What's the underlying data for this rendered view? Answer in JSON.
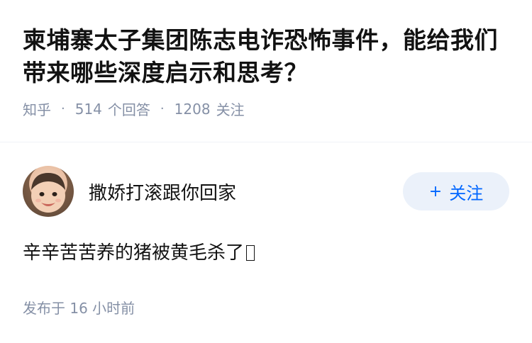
{
  "question": {
    "title": "柬埔寨太子集团陈志电诈恐怖事件，能给我们带来哪些深度启示和思考？",
    "source": "知乎",
    "answer_count": "514",
    "answer_label": "个回答",
    "follower_count": "1208",
    "follower_label": "关注",
    "separator": "·"
  },
  "answer": {
    "author_name": "撒娇打滚跟你回家",
    "follow_button": {
      "icon": "plus-icon",
      "plus_glyph": "+",
      "label": "关注"
    },
    "content": "辛辛苦苦养的猪被黄毛杀了",
    "published_prefix": "发布于",
    "published_time": "16 小时前"
  },
  "colors": {
    "title": "#121212",
    "meta": "#8590a6",
    "follow_bg": "#ebf1fa",
    "follow_text": "#0066ff"
  }
}
